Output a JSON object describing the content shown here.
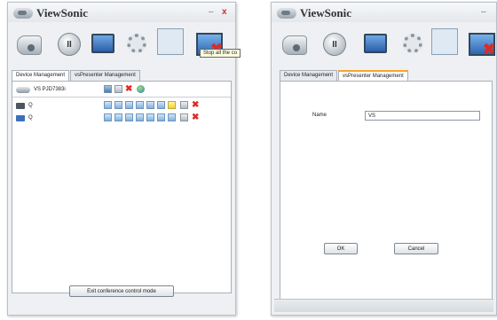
{
  "app": {
    "brand": "ViewSonic",
    "minimize": "–",
    "close": "x"
  },
  "colors": {
    "accent_tab": "#f4a531",
    "delete_red": "#e02b24",
    "window_bg": "#eef0f3"
  },
  "icons": {
    "toolbar": [
      "camera-icon",
      "pause-icon",
      "monitor-icon",
      "settings-gear-icon",
      "quad-split-icon",
      "stop-display-icon"
    ]
  },
  "left": {
    "tabs": [
      "Device Management",
      "vsPresenter Management"
    ],
    "tooltip": "Stop all the co",
    "devices": [
      {
        "label": "VS PJD7383i",
        "icon": "projector-icon"
      },
      {
        "label": "Q",
        "icon": "computer-icon"
      },
      {
        "label": "Q",
        "icon": "computer-icon"
      }
    ],
    "exit_button": "Exit conference control mode"
  },
  "right": {
    "tabs": [
      "Device Management",
      "vsPresenter Management"
    ],
    "name_label": "Name",
    "name_value": "VS",
    "ok_button": "OK",
    "cancel_button": "Cancel"
  }
}
